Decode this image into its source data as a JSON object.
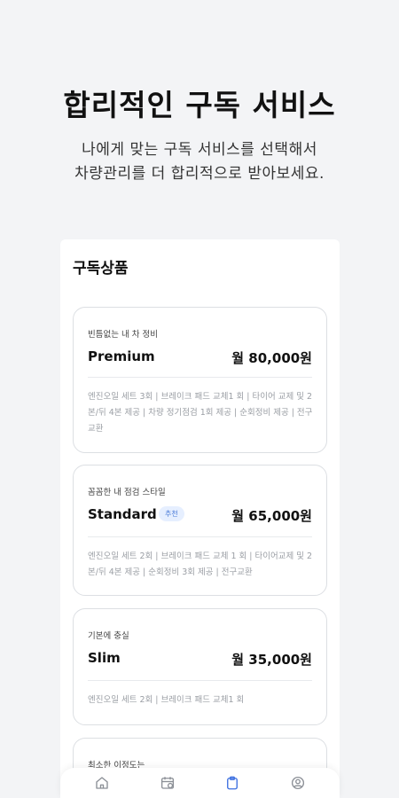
{
  "hero": {
    "title": "합리적인 구독 서비스",
    "subtitle_line1": "나에게 맞는 구독 서비스를 선택해서",
    "subtitle_line2": "차량관리를 더 합리적으로 받아보세요."
  },
  "panel": {
    "title": "구독상품"
  },
  "plans": [
    {
      "tag": "빈틈없는 내 차 정비",
      "name": "Premium",
      "price": "월 80,000원",
      "badge": "",
      "description": "엔진오일 세트 3회 | 브레이크 패드 교체1 회 | 타이어 교제 및 2본/뒤 4본 제공 | 차량 정기점검 1회 제공 | 순회정비 제공 | 전구교환"
    },
    {
      "tag": "꼼꼼한 내 점검 스타일",
      "name": "Standard",
      "price": "월 65,000원",
      "badge": "추천",
      "description": "엔진오일 세트 2회 | 브레이크 패드 교체 1 회 | 타이어교제 및 2본/뒤 4본 제공 | 순회정비 3회 제공 | 전구교환"
    },
    {
      "tag": "기본에 충실",
      "name": "Slim",
      "price": "월 35,000원",
      "badge": "",
      "description": "엔진오일 세트 2회 | 브레이크 패드 교체1 회"
    },
    {
      "tag": "최소한 이정도는",
      "name": "",
      "price": "",
      "badge": "",
      "description": ""
    }
  ],
  "tabbar": {
    "tabs": [
      {
        "icon": "home-icon",
        "active": false
      },
      {
        "icon": "calendar-check-icon",
        "active": false
      },
      {
        "icon": "clipboard-icon",
        "active": true
      },
      {
        "icon": "user-circle-icon",
        "active": false
      }
    ],
    "active_color": "#3b6fe0",
    "inactive_color": "#8b8f96"
  }
}
